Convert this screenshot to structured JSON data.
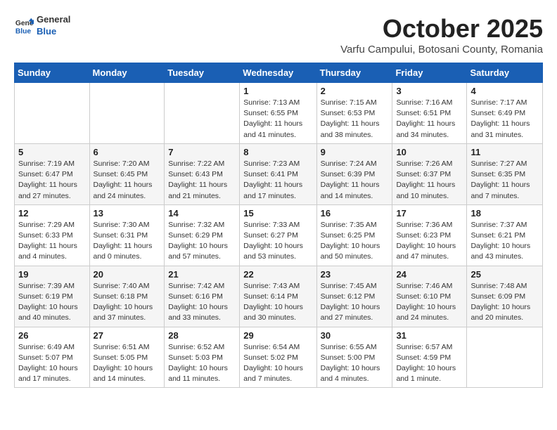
{
  "header": {
    "logo": {
      "general": "General",
      "blue": "Blue"
    },
    "month": "October 2025",
    "location": "Varfu Campului, Botosani County, Romania"
  },
  "weekdays": [
    "Sunday",
    "Monday",
    "Tuesday",
    "Wednesday",
    "Thursday",
    "Friday",
    "Saturday"
  ],
  "weeks": [
    [
      {
        "day": "",
        "info": ""
      },
      {
        "day": "",
        "info": ""
      },
      {
        "day": "",
        "info": ""
      },
      {
        "day": "1",
        "info": "Sunrise: 7:13 AM\nSunset: 6:55 PM\nDaylight: 11 hours\nand 41 minutes."
      },
      {
        "day": "2",
        "info": "Sunrise: 7:15 AM\nSunset: 6:53 PM\nDaylight: 11 hours\nand 38 minutes."
      },
      {
        "day": "3",
        "info": "Sunrise: 7:16 AM\nSunset: 6:51 PM\nDaylight: 11 hours\nand 34 minutes."
      },
      {
        "day": "4",
        "info": "Sunrise: 7:17 AM\nSunset: 6:49 PM\nDaylight: 11 hours\nand 31 minutes."
      }
    ],
    [
      {
        "day": "5",
        "info": "Sunrise: 7:19 AM\nSunset: 6:47 PM\nDaylight: 11 hours\nand 27 minutes."
      },
      {
        "day": "6",
        "info": "Sunrise: 7:20 AM\nSunset: 6:45 PM\nDaylight: 11 hours\nand 24 minutes."
      },
      {
        "day": "7",
        "info": "Sunrise: 7:22 AM\nSunset: 6:43 PM\nDaylight: 11 hours\nand 21 minutes."
      },
      {
        "day": "8",
        "info": "Sunrise: 7:23 AM\nSunset: 6:41 PM\nDaylight: 11 hours\nand 17 minutes."
      },
      {
        "day": "9",
        "info": "Sunrise: 7:24 AM\nSunset: 6:39 PM\nDaylight: 11 hours\nand 14 minutes."
      },
      {
        "day": "10",
        "info": "Sunrise: 7:26 AM\nSunset: 6:37 PM\nDaylight: 11 hours\nand 10 minutes."
      },
      {
        "day": "11",
        "info": "Sunrise: 7:27 AM\nSunset: 6:35 PM\nDaylight: 11 hours\nand 7 minutes."
      }
    ],
    [
      {
        "day": "12",
        "info": "Sunrise: 7:29 AM\nSunset: 6:33 PM\nDaylight: 11 hours\nand 4 minutes."
      },
      {
        "day": "13",
        "info": "Sunrise: 7:30 AM\nSunset: 6:31 PM\nDaylight: 11 hours\nand 0 minutes."
      },
      {
        "day": "14",
        "info": "Sunrise: 7:32 AM\nSunset: 6:29 PM\nDaylight: 10 hours\nand 57 minutes."
      },
      {
        "day": "15",
        "info": "Sunrise: 7:33 AM\nSunset: 6:27 PM\nDaylight: 10 hours\nand 53 minutes."
      },
      {
        "day": "16",
        "info": "Sunrise: 7:35 AM\nSunset: 6:25 PM\nDaylight: 10 hours\nand 50 minutes."
      },
      {
        "day": "17",
        "info": "Sunrise: 7:36 AM\nSunset: 6:23 PM\nDaylight: 10 hours\nand 47 minutes."
      },
      {
        "day": "18",
        "info": "Sunrise: 7:37 AM\nSunset: 6:21 PM\nDaylight: 10 hours\nand 43 minutes."
      }
    ],
    [
      {
        "day": "19",
        "info": "Sunrise: 7:39 AM\nSunset: 6:19 PM\nDaylight: 10 hours\nand 40 minutes."
      },
      {
        "day": "20",
        "info": "Sunrise: 7:40 AM\nSunset: 6:18 PM\nDaylight: 10 hours\nand 37 minutes."
      },
      {
        "day": "21",
        "info": "Sunrise: 7:42 AM\nSunset: 6:16 PM\nDaylight: 10 hours\nand 33 minutes."
      },
      {
        "day": "22",
        "info": "Sunrise: 7:43 AM\nSunset: 6:14 PM\nDaylight: 10 hours\nand 30 minutes."
      },
      {
        "day": "23",
        "info": "Sunrise: 7:45 AM\nSunset: 6:12 PM\nDaylight: 10 hours\nand 27 minutes."
      },
      {
        "day": "24",
        "info": "Sunrise: 7:46 AM\nSunset: 6:10 PM\nDaylight: 10 hours\nand 24 minutes."
      },
      {
        "day": "25",
        "info": "Sunrise: 7:48 AM\nSunset: 6:09 PM\nDaylight: 10 hours\nand 20 minutes."
      }
    ],
    [
      {
        "day": "26",
        "info": "Sunrise: 6:49 AM\nSunset: 5:07 PM\nDaylight: 10 hours\nand 17 minutes."
      },
      {
        "day": "27",
        "info": "Sunrise: 6:51 AM\nSunset: 5:05 PM\nDaylight: 10 hours\nand 14 minutes."
      },
      {
        "day": "28",
        "info": "Sunrise: 6:52 AM\nSunset: 5:03 PM\nDaylight: 10 hours\nand 11 minutes."
      },
      {
        "day": "29",
        "info": "Sunrise: 6:54 AM\nSunset: 5:02 PM\nDaylight: 10 hours\nand 7 minutes."
      },
      {
        "day": "30",
        "info": "Sunrise: 6:55 AM\nSunset: 5:00 PM\nDaylight: 10 hours\nand 4 minutes."
      },
      {
        "day": "31",
        "info": "Sunrise: 6:57 AM\nSunset: 4:59 PM\nDaylight: 10 hours\nand 1 minute."
      },
      {
        "day": "",
        "info": ""
      }
    ]
  ]
}
